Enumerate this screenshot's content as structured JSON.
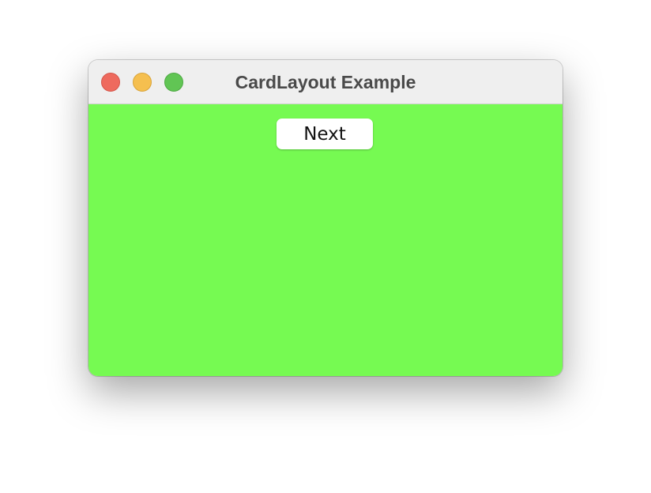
{
  "window": {
    "title": "CardLayout Example"
  },
  "content": {
    "next_label": "Next",
    "background_color": "#76fa52"
  }
}
